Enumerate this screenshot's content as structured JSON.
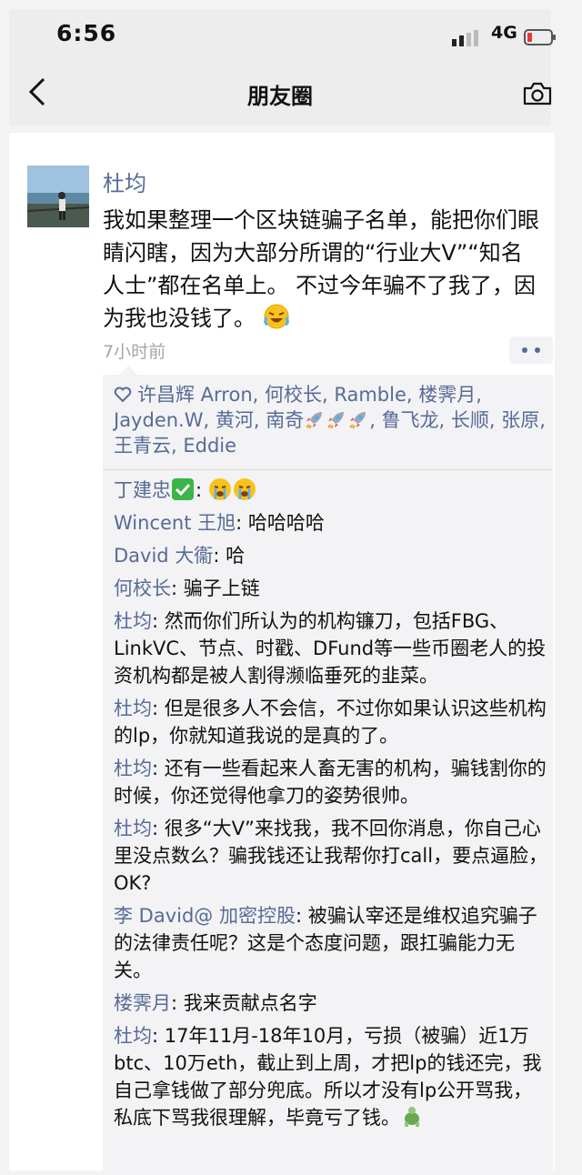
{
  "status": {
    "time": "6:56",
    "network": "4G"
  },
  "nav": {
    "title": "朋友圈"
  },
  "post": {
    "author": "杜均",
    "text": "我如果整理一个区块链骗子名单，能把你们眼睛闪瞎，因为大部分所谓的“行业大V”“知名人士”都在名单上。 不过今年骗不了我了，因为我也没钱了。",
    "time": "7小时前",
    "likes_part1": "许昌辉 Arron, 何校长, Ramble, 楼霁月, Jayden.W, 黄河, 南奇",
    "likes_part2": ", 鲁飞龙, 长顺, 张原, 王青云, Eddie",
    "comments": [
      {
        "name": "丁建忠",
        "text": ":"
      },
      {
        "name": "Wincent 王旭",
        "text": ": 哈哈哈哈"
      },
      {
        "name": "David 大衞",
        "text": ": 哈"
      },
      {
        "name": "何校长",
        "text": ": 骗子上链"
      },
      {
        "name": "杜均",
        "text": ": 然而你们所认为的机构镰刀，包括FBG、LinkVC、节点、时戳、DFund等一些币圈老人的投资机构都是被人割得濒临垂死的韭菜。"
      },
      {
        "name": "杜均",
        "text": ": 但是很多人不会信，不过你如果认识这些机构的lp，你就知道我说的是真的了。"
      },
      {
        "name": "杜均",
        "text": ": 还有一些看起来人畜无害的机构，骗钱割你的时候，你还觉得他拿刀的姿势很帅。"
      },
      {
        "name": "杜均",
        "text": ": 很多“大V”来找我，我不回你消息，你自己心里没点数么？骗我钱还让我帮你打call，要点逼脸，OK?"
      },
      {
        "name": "李 David@ 加密控股",
        "text": ": 被骗认宰还是维权追究骗子的法律责任呢？这是个态度问题，跟扛骗能力无关。"
      },
      {
        "name": "楼霁月",
        "text": ": 我来贡献点名字"
      },
      {
        "name": "杜均",
        "text": ": 17年11月-18年10月，亏损（被骗）近1万btc、10万eth，截止到上周，才把lp的钱还完，我自己拿钱做了部分兜底。所以才没有lp公开骂我，私底下骂我很理解，毕竟亏了钱。"
      }
    ]
  },
  "colors": {
    "link": "#576b95",
    "time": "#a6a6a6",
    "comment_bg": "#f3f3f5"
  },
  "icons": [
    "signal-icon",
    "battery-icon",
    "back-icon",
    "camera-icon",
    "heart-icon",
    "rocket-icon",
    "laughing-emoji",
    "check-emoji",
    "sob-emoji",
    "turtle-emoji"
  ]
}
